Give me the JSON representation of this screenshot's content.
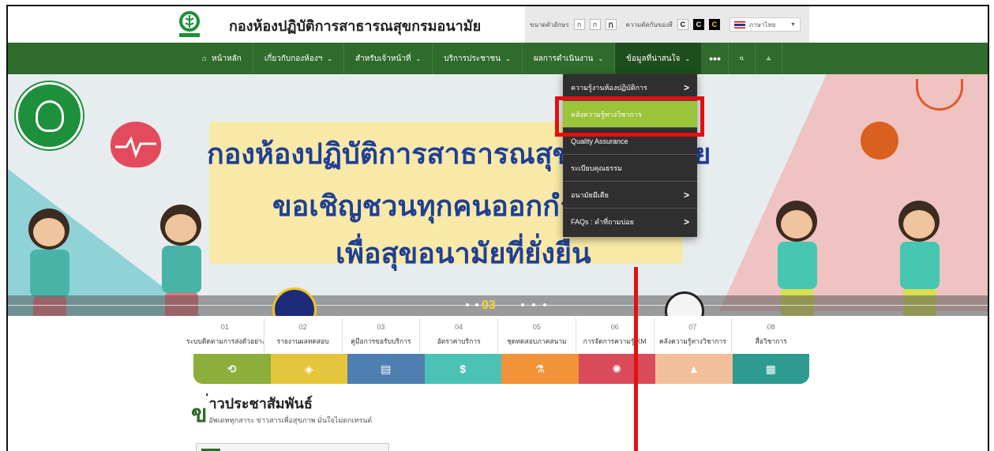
{
  "header": {
    "site_title": "กองห้องปฏิบัติการสาธารณสุขกรมอนามัย",
    "logo_icon": "department-of-health-logo",
    "font_size_label": "ขนาดตัวอักษร",
    "font_small": "ก",
    "font_medium": "ก",
    "font_large": "ก",
    "contrast_label": "ความตัดกันของสี",
    "contrast_normal": "C",
    "contrast_black": "C",
    "contrast_yellow": "C",
    "language": "ภาษาไทย"
  },
  "nav": {
    "items": [
      {
        "label": "หน้าหลัก",
        "icon": "home-icon",
        "has_dropdown": false
      },
      {
        "label": "เกี่ยวกับกองห้องฯ",
        "has_dropdown": true
      },
      {
        "label": "สำหรับเจ้าหน้าที่",
        "has_dropdown": true
      },
      {
        "label": "บริการประชาชน",
        "has_dropdown": true
      },
      {
        "label": "ผลการดำเนินงาน",
        "has_dropdown": true
      },
      {
        "label": "ข้อมูลที่น่าสนใจ",
        "has_dropdown": true
      }
    ],
    "more": "•••",
    "search_icon": "search-icon",
    "sitemap_icon": "sitemap-icon"
  },
  "dropdown": {
    "items": [
      {
        "label": "ความรู้งานห้องปฏิบัติการ",
        "has_sub": true
      },
      {
        "label": "คลังความรู้ทางวิชาการ",
        "has_sub": false,
        "highlighted": true
      },
      {
        "label": "Quality Assurance",
        "has_sub": false
      },
      {
        "label": "ระเบียบคุณธรรม",
        "has_sub": false
      },
      {
        "label": "อนามัยมีเดีย",
        "has_sub": true
      },
      {
        "label": "FAQs : คำที่ถามบ่อย",
        "has_sub": true
      }
    ]
  },
  "hero": {
    "line1": "กองห้องปฏิบัติการสาธารณสุขกรมอนามัย",
    "line2": "ขอเชิญชวนทุกคนออกกำลังกาย",
    "line3": "เพื่อสุขอนามัยที่ยั่งยืน",
    "slide_number": "03"
  },
  "services": [
    {
      "num": "01",
      "label": "ระบบติดตามการส่งตัวอย่างน้ำ"
    },
    {
      "num": "02",
      "label": "รายงานผลทดสอบ"
    },
    {
      "num": "03",
      "label": "คู่มือการขอรับบริการ"
    },
    {
      "num": "04",
      "label": "อัตราค่าบริการ"
    },
    {
      "num": "05",
      "label": "ชุดทดสอบภาคสนาม"
    },
    {
      "num": "06",
      "label": "การจัดการความรู้ KM"
    },
    {
      "num": "07",
      "label": "คลังความรู้ทางวิชาการ"
    },
    {
      "num": "08",
      "label": "สื่อวิชาการ"
    }
  ],
  "colorbar": [
    {
      "icon": "history-icon",
      "glyph": "⟲",
      "color": "#8cae3a"
    },
    {
      "icon": "badge-icon",
      "glyph": "◈",
      "color": "#e5c53c"
    },
    {
      "icon": "clipboard-icon",
      "glyph": "▤",
      "color": "#4f7fb0"
    },
    {
      "icon": "dollar-icon",
      "glyph": "$",
      "color": "#4cc2b5"
    },
    {
      "icon": "flask-icon",
      "glyph": "⚗",
      "color": "#f2933a"
    },
    {
      "icon": "lightbulb-icon",
      "glyph": "✺",
      "color": "#d94b5a"
    },
    {
      "icon": "graduation-cap-icon",
      "glyph": "▲",
      "color": "#f1c09a"
    },
    {
      "icon": "film-icon",
      "glyph": "▦",
      "color": "#2f9a8f"
    }
  ],
  "news": {
    "big_letter": "ข",
    "title": "่าวประชาสัมพันธ์",
    "subtitle": "อัพเดททุกสาระ ข่าวสารเพื่อสุขภาพ มั่นใจไม่ตกเทรนด์"
  },
  "colors": {
    "nav_green": "#2f6b2c",
    "highlight_green": "#9ac43a",
    "annotation_red": "#e21010",
    "hero_blue_text": "#1e3f95"
  }
}
